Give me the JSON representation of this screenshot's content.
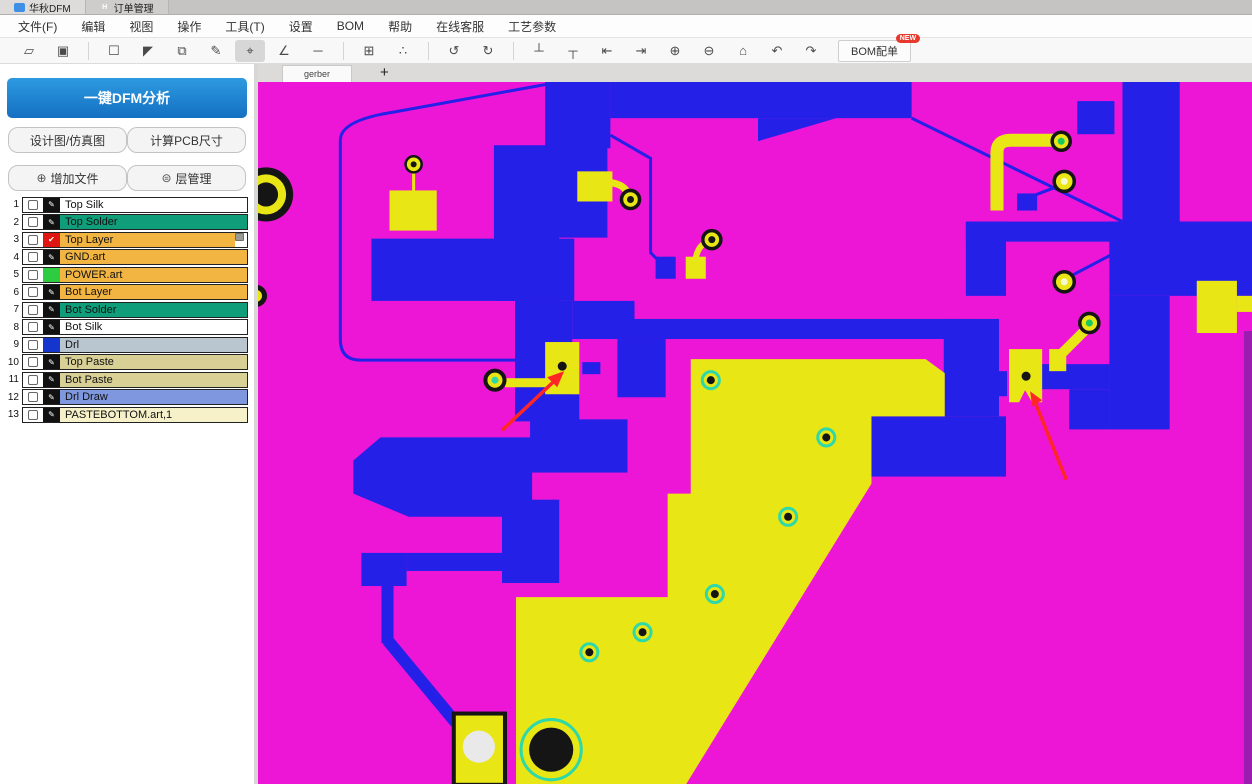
{
  "window_tabs": [
    {
      "label": "华秋DFM"
    },
    {
      "label": "订单管理"
    }
  ],
  "menu": {
    "items": [
      {
        "label": "文件(F)"
      },
      {
        "label": "编辑"
      },
      {
        "label": "视图"
      },
      {
        "label": "操作"
      },
      {
        "label": "工具(T)"
      },
      {
        "label": "设置"
      },
      {
        "label": "BOM"
      },
      {
        "label": "帮助"
      },
      {
        "label": "在线客服"
      },
      {
        "label": "工艺参数"
      }
    ]
  },
  "toolbar": {
    "icons": [
      {
        "name": "open-folder-icon",
        "glyph": "▱"
      },
      {
        "name": "save-icon",
        "glyph": "▣"
      },
      {
        "name": "select-rect-icon",
        "glyph": "☐"
      },
      {
        "name": "cursor-select-icon",
        "glyph": "◤"
      },
      {
        "name": "copy-view-icon",
        "glyph": "⧉"
      },
      {
        "name": "draw-edit-icon",
        "glyph": "✎"
      },
      {
        "name": "measure-icon",
        "glyph": "⌖"
      },
      {
        "name": "angle-measure-icon",
        "glyph": "∠"
      },
      {
        "name": "line-icon",
        "glyph": "─"
      },
      {
        "name": "grid-icon",
        "glyph": "⊞"
      },
      {
        "name": "net-nodes-icon",
        "glyph": "∴"
      },
      {
        "name": "rotate-left-icon",
        "glyph": "↺"
      },
      {
        "name": "rotate-right-icon",
        "glyph": "↻"
      },
      {
        "name": "align-bottom-icon",
        "glyph": "┴"
      },
      {
        "name": "align-top-icon",
        "glyph": "┬"
      },
      {
        "name": "pan-left-icon",
        "glyph": "⇤"
      },
      {
        "name": "pan-right-icon",
        "glyph": "⇥"
      },
      {
        "name": "zoom-in-icon",
        "glyph": "⊕"
      },
      {
        "name": "zoom-out-icon",
        "glyph": "⊖"
      },
      {
        "name": "fit-view-icon",
        "glyph": "⌂"
      },
      {
        "name": "undo-icon",
        "glyph": "↶"
      },
      {
        "name": "redo-icon",
        "glyph": "↷"
      }
    ],
    "bom_button": {
      "label": "BOM配单",
      "badge": "NEW"
    }
  },
  "sidebar": {
    "dfm_button_label": "一键DFM分析",
    "buttons": [
      {
        "label": "设计图/仿真图",
        "icon": ""
      },
      {
        "label": "计算PCB尺寸",
        "icon": ""
      },
      {
        "label": "增加文件",
        "icon": "⊕"
      },
      {
        "label": "层管理",
        "icon": "⊜"
      }
    ],
    "layers": [
      {
        "num": "1",
        "name": "Top Silk",
        "bar": "#ffffff",
        "swatch": "#111111",
        "glyph": "✎"
      },
      {
        "num": "2",
        "name": "Top Solder",
        "bar": "#0f9e79",
        "swatch": "#111111",
        "glyph": "✎"
      },
      {
        "num": "3",
        "name": "Top Layer",
        "bar": "#f2b542",
        "swatch": "#dd1612",
        "glyph": "✔"
      },
      {
        "num": "4",
        "name": "GND.art",
        "bar": "#f2b542",
        "swatch": "#111111",
        "glyph": "✎"
      },
      {
        "num": "5",
        "name": "POWER.art",
        "bar": "#f2b542",
        "swatch": "#2ecc40",
        "glyph": ""
      },
      {
        "num": "6",
        "name": "Bot Layer",
        "bar": "#f2b542",
        "swatch": "#111111",
        "glyph": "✎"
      },
      {
        "num": "7",
        "name": "Bot Solder",
        "bar": "#0f9e79",
        "swatch": "#111111",
        "glyph": "✎"
      },
      {
        "num": "8",
        "name": "Bot Silk",
        "bar": "#ffffff",
        "swatch": "#111111",
        "glyph": "✎"
      },
      {
        "num": "9",
        "name": "Drl",
        "bar": "#b9c6cf",
        "swatch": "#1535cf",
        "glyph": ""
      },
      {
        "num": "10",
        "name": "Top Paste",
        "bar": "#d9d096",
        "swatch": "#111111",
        "glyph": "✎"
      },
      {
        "num": "11",
        "name": "Bot Paste",
        "bar": "#d9d096",
        "swatch": "#111111",
        "glyph": "✎"
      },
      {
        "num": "12",
        "name": "Drl Draw",
        "bar": "#7e97de",
        "swatch": "#111111",
        "glyph": "✎"
      },
      {
        "num": "13",
        "name": "PASTEBOTTOM.art,1",
        "bar": "#f6f1c9",
        "swatch": "#111111",
        "glyph": "✎"
      }
    ]
  },
  "main": {
    "doc_tab_label": "gerber",
    "new_tab_label": "+"
  },
  "pcb": {
    "palette": {
      "mg": "#ee16d6",
      "cu": "#2420e8",
      "au": "#e9e616",
      "ink": "#151515",
      "via": "#2fd8a8",
      "red": "#ff2626",
      "white": "#e9e9e9",
      "edge": "#8b1fa8"
    }
  }
}
